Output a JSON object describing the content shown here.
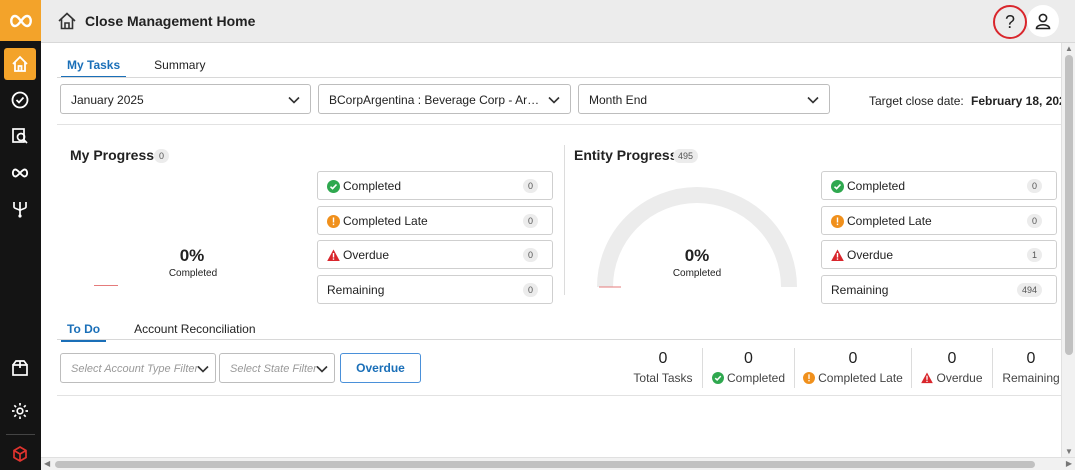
{
  "header": {
    "title": "Close Management Home",
    "help_label": "?"
  },
  "rail": {
    "items": [
      "logo-icon",
      "home-icon",
      "tasks-check-icon",
      "reconciliation-icon",
      "infinity-icon",
      "workflow-icon",
      "package-icon",
      "settings-icon",
      "brand-cube-icon"
    ],
    "accent": "#f3a32a"
  },
  "tabs": {
    "my_tasks": "My Tasks",
    "summary": "Summary"
  },
  "filters": {
    "period": "January 2025",
    "entity": "BCorpArgentina : Beverage Corp - Argen…",
    "close_type": "Month End",
    "target_label": "Target close date:",
    "target_value": "February 18, 202"
  },
  "my_progress": {
    "title": "My Progress",
    "count": "0",
    "percent": "0%",
    "percent_label": "Completed",
    "stats": [
      {
        "label": "Completed",
        "value": "0"
      },
      {
        "label": "Completed Late",
        "value": "0"
      },
      {
        "label": "Overdue",
        "value": "0"
      },
      {
        "label": "Remaining",
        "value": "0"
      }
    ]
  },
  "entity_progress": {
    "title": "Entity Progress",
    "count": "495",
    "percent": "0%",
    "percent_label": "Completed",
    "stats": [
      {
        "label": "Completed",
        "value": "0"
      },
      {
        "label": "Completed Late",
        "value": "0"
      },
      {
        "label": "Overdue",
        "value": "1"
      },
      {
        "label": "Remaining",
        "value": "494"
      }
    ]
  },
  "lower_tabs": {
    "todo": "To Do",
    "account_reconciliation": "Account Reconciliation"
  },
  "todo_filters": {
    "account_type_placeholder": "Select Account Type Filter",
    "state_placeholder": "Select State Filter",
    "overdue_button": "Overdue"
  },
  "summary_counts": [
    {
      "value": "0",
      "label": "Total Tasks"
    },
    {
      "value": "0",
      "label": "Completed"
    },
    {
      "value": "0",
      "label": "Completed Late"
    },
    {
      "value": "0",
      "label": "Overdue"
    },
    {
      "value": "0",
      "label": "Remaining"
    }
  ],
  "colors": {
    "accent_blue": "#1a6fb8",
    "success": "#2fa84f",
    "warning": "#f0901c",
    "danger": "#d9262c",
    "help_ring": "#d9262c"
  }
}
